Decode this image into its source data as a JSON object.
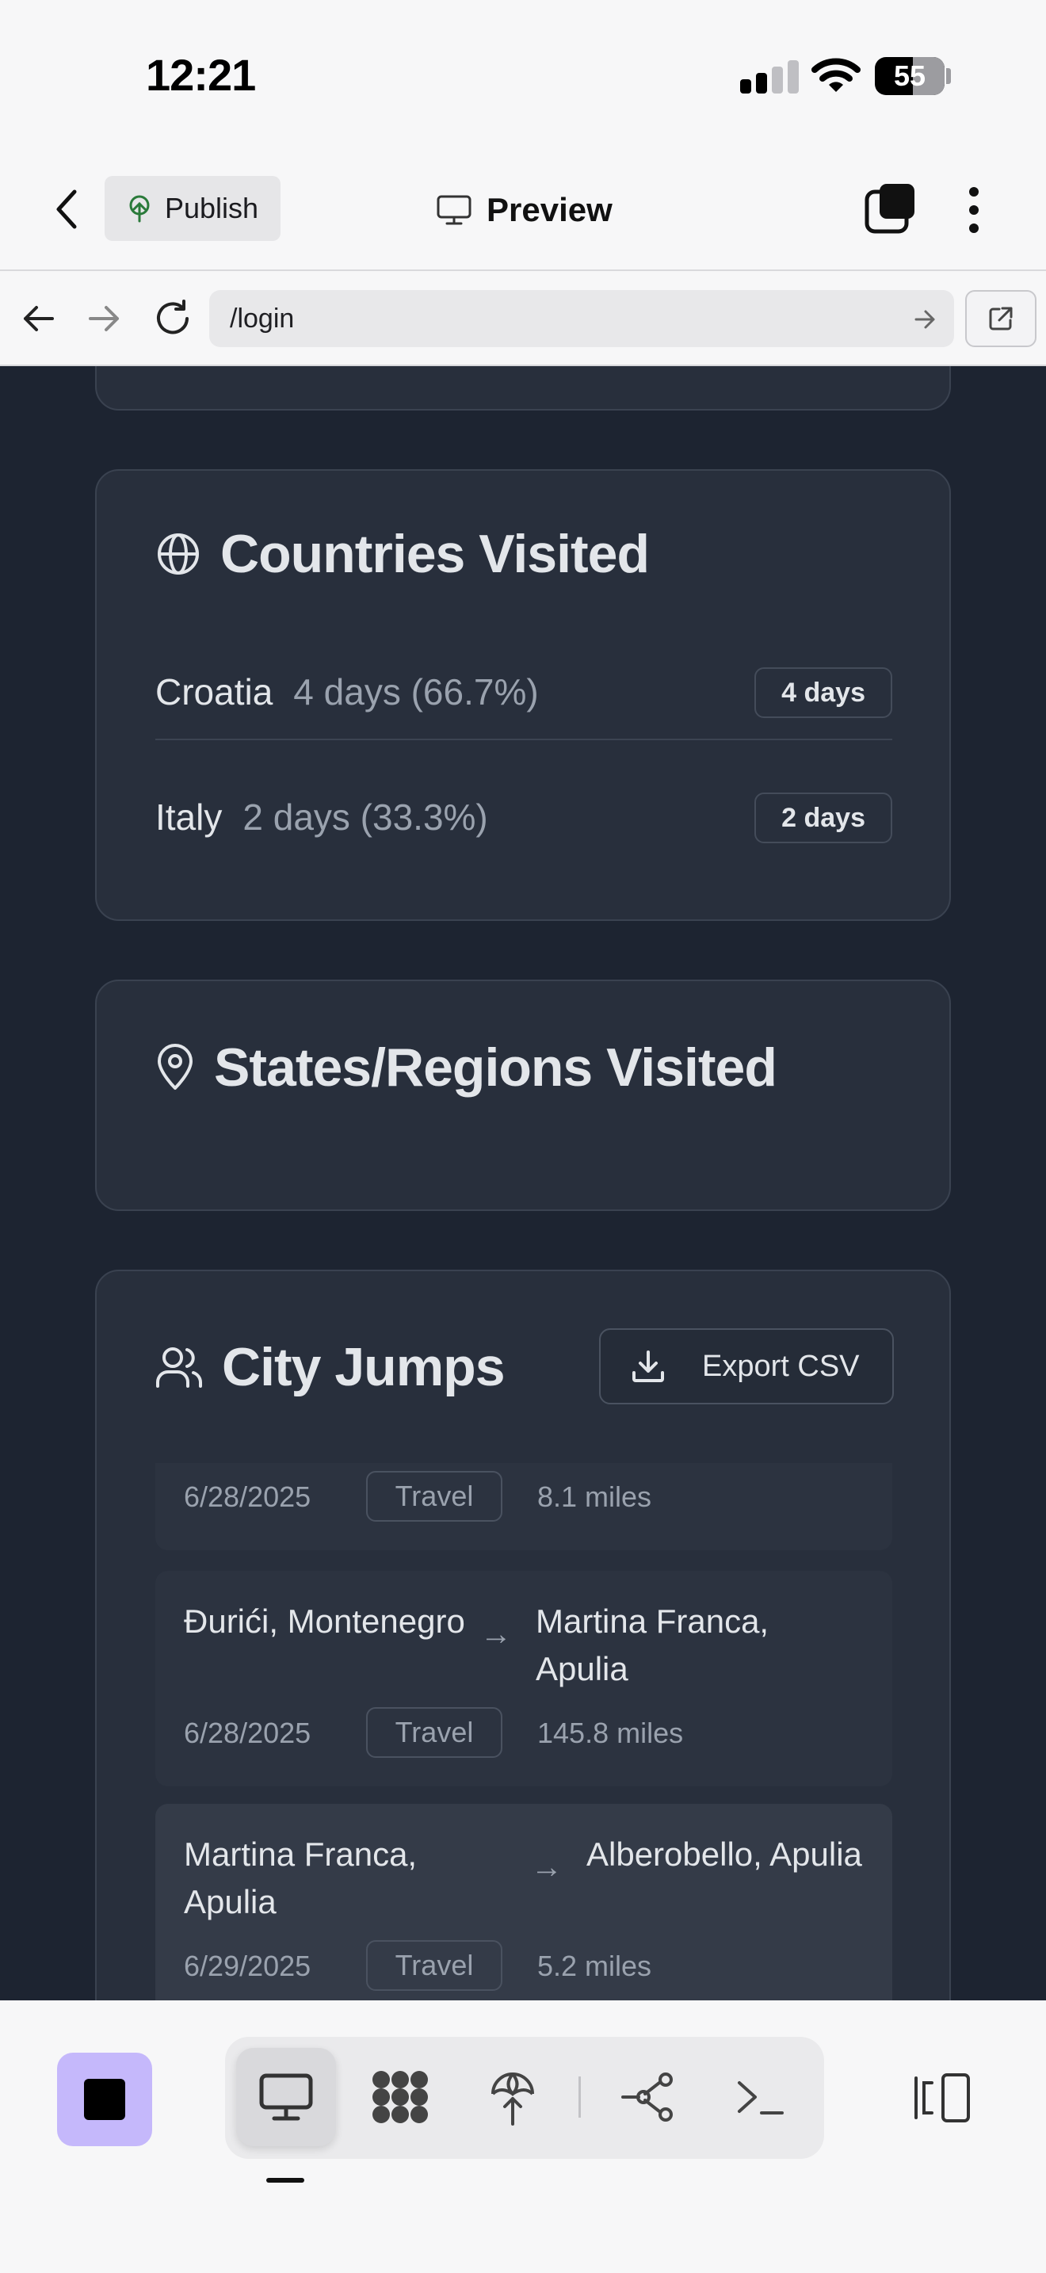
{
  "status_bar": {
    "time": "12:21",
    "battery": "55"
  },
  "app_bar": {
    "publish_label": "Publish",
    "title": "Preview"
  },
  "browser": {
    "url": "/login"
  },
  "countries_card": {
    "title": "Countries Visited",
    "items": [
      {
        "name": "Croatia",
        "detail": "4 days (66.7%)",
        "badge": "4 days"
      },
      {
        "name": "Italy",
        "detail": "2 days (33.3%)",
        "badge": "2 days"
      }
    ]
  },
  "regions_card": {
    "title": "States/Regions Visited"
  },
  "city_jumps_card": {
    "title": "City Jumps",
    "export_label": "Export CSV",
    "jumps": [
      {
        "from": "",
        "to": "",
        "date": "6/28/2025",
        "type": "Travel",
        "distance": "8.1 miles"
      },
      {
        "from": "Đurići, Montenegro",
        "to": "Martina Franca, Apulia",
        "date": "6/28/2025",
        "type": "Travel",
        "distance": "145.8 miles"
      },
      {
        "from": "Martina Franca, Apulia",
        "to": "Alberobello, Apulia",
        "date": "6/29/2025",
        "type": "Travel",
        "distance": "5.2 miles"
      }
    ]
  },
  "bottom_toolbar": {
    "tools": [
      "preview-icon",
      "assets-icon",
      "deploy-icon",
      "git-icon",
      "terminal-icon"
    ],
    "accent_color": "#c5b8fb"
  }
}
